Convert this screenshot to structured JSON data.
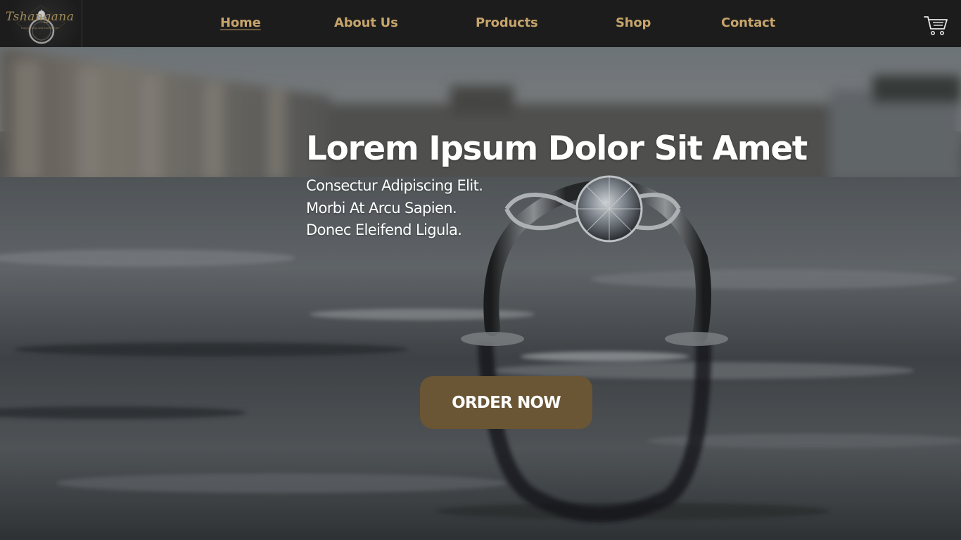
{
  "brand": {
    "name": "Tshangana",
    "tagline": "Luxury Rings and Accessories"
  },
  "nav": {
    "items": [
      {
        "label": "Home",
        "active": true
      },
      {
        "label": "About Us",
        "active": false
      },
      {
        "label": "Products",
        "active": false
      },
      {
        "label": "Shop",
        "active": false
      },
      {
        "label": "Contact",
        "active": false
      }
    ],
    "cart_icon": "shopping-cart-icon"
  },
  "hero": {
    "title": "Lorem Ipsum Dolor Sit Amet",
    "lines": [
      "Consectur Adipiscing Elit.",
      "Morbi At Arcu Sapien.",
      "Donec Eleifend Ligula."
    ],
    "cta_label": "ORDER NOW",
    "background": "engagement-ring-in-water-photo"
  },
  "colors": {
    "nav_bg": "#1c1c1c",
    "nav_link": "#c6a46b",
    "button_bg": "#6a5534",
    "text_light": "#ffffff"
  }
}
